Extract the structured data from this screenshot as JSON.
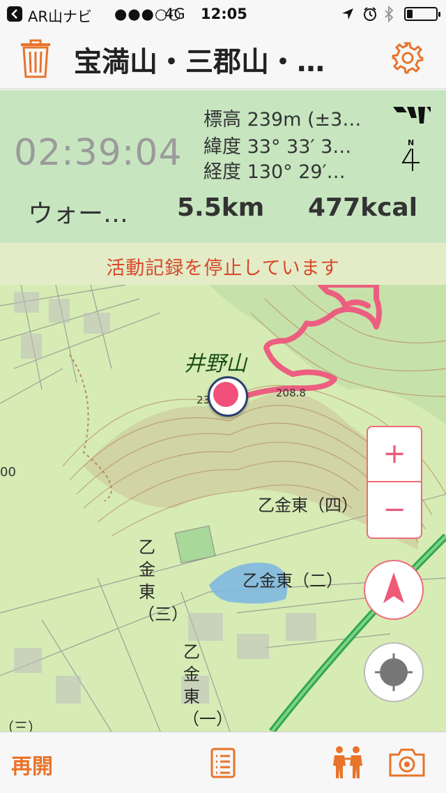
{
  "status_bar": {
    "back_app": "AR山ナビ",
    "signal": "●●●○○",
    "network": "4G",
    "time": "12:05",
    "battery_level": 0.2
  },
  "nav": {
    "title": "宝満山・三郡山・…",
    "trash_icon": "trash-icon",
    "settings_icon": "gear-icon"
  },
  "info": {
    "timer": "02:39:04",
    "elevation": "標高 239m (±3…",
    "latitude": "緯度 33° 33′ 3…",
    "longitude": "経度 130° 29′…",
    "compass_label": "N",
    "activity": "ウォー…",
    "distance": "5.5km",
    "calories": "477kcal"
  },
  "banner": {
    "message": "活動記録を停止しています"
  },
  "map": {
    "peak_name": "井野山",
    "elevation_marks": [
      "23",
      "208.8"
    ],
    "place_labels": {
      "otogane_higashi_4": "乙金東（四）",
      "otogane_higashi_2": "乙金東（二）",
      "otogane_higashi_3_vertical": "乙金東（三）",
      "otogane_higashi_vertical": "乙金東（一）",
      "edge_label": "（三）",
      "edge_number": "00"
    },
    "zoom_in": "+",
    "zoom_out": "−"
  },
  "toolbar": {
    "resume": "再開",
    "list_icon": "list-icon",
    "people_icon": "people-icon",
    "camera_icon": "camera-icon"
  },
  "colors": {
    "accent": "#e8732a",
    "track": "#f0507a",
    "banner_text": "#d9482b",
    "info_bg": "#c7e6c0"
  }
}
